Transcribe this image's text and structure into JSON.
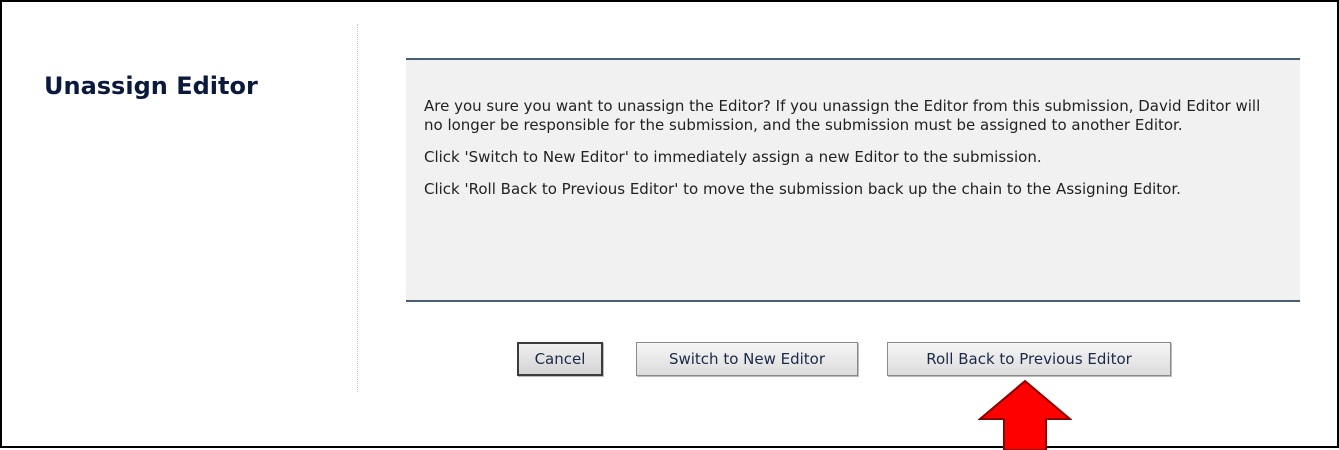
{
  "page": {
    "title": "Unassign Editor"
  },
  "message": {
    "paragraphs": [
      "Are you sure you want to unassign the Editor? If you unassign the Editor from this submission, David Editor will no longer be responsible for the submission, and the submission must be assigned to another Editor.",
      "Click 'Switch to New Editor' to immediately assign a new Editor to the submission.",
      "Click 'Roll Back to Previous Editor' to move the submission back up the chain to the Assigning Editor."
    ]
  },
  "buttons": {
    "cancel": "Cancel",
    "switch": "Switch to New Editor",
    "rollback": "Roll Back to Previous Editor"
  },
  "annotation": {
    "arrow_icon": "red-up-arrow-icon",
    "arrow_color": "#ff0000"
  },
  "colors": {
    "title": "#0b1a3c",
    "box_background": "#f1f1f2",
    "box_border": "#4a5f74"
  }
}
